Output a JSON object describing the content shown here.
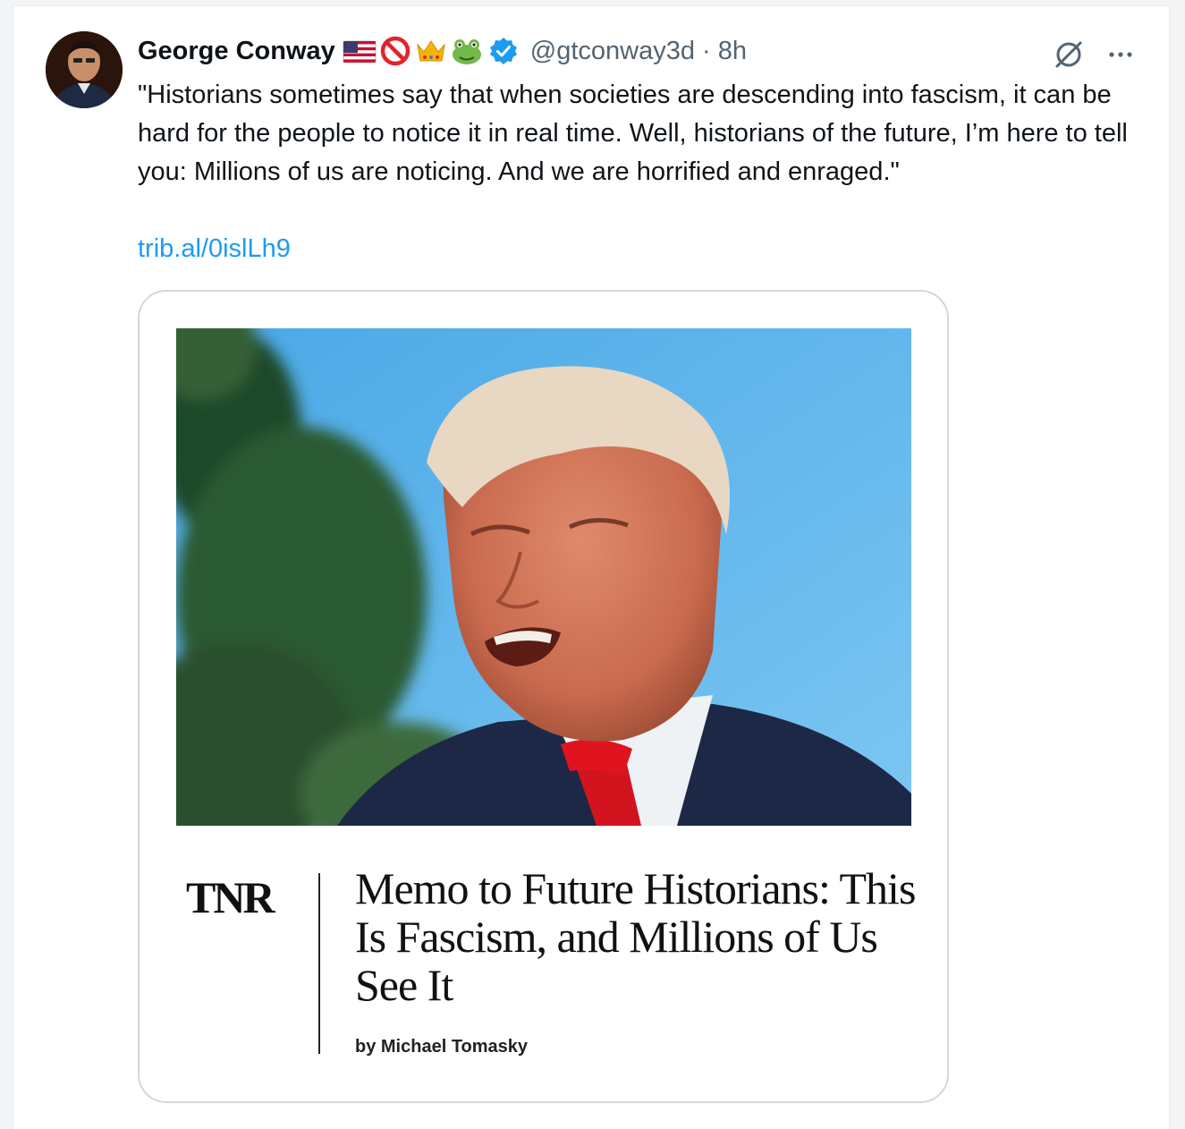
{
  "tweet": {
    "author_name": "George Conway",
    "emoji_icons": [
      "us-flag-icon",
      "prohibited-icon",
      "crown-icon",
      "frog-icon"
    ],
    "verified_icon": "verified-badge-icon",
    "handle_and_time": "@gtconway3d · 8h",
    "text": "\"Historians sometimes say that when societies are descending into fascism, it can be hard for the people to notice it in real time. Well, historians of the future, I’m here to tell you: Millions of us are noticing. And we are horrified and enraged.\"",
    "link": "trib.al/0islLh9",
    "actions": [
      "grok-icon",
      "more-options-icon"
    ]
  },
  "card": {
    "brand": "TNR",
    "headline": "Memo to Future Historians: This Is Fascism, and Millions of Us See It",
    "byline": "by Michael Tomasky"
  },
  "colors": {
    "link": "#1d9bf0",
    "verified": "#1d9bf0",
    "text": "#0f1419",
    "muted": "#536471",
    "card_border": "#cfd9de"
  }
}
